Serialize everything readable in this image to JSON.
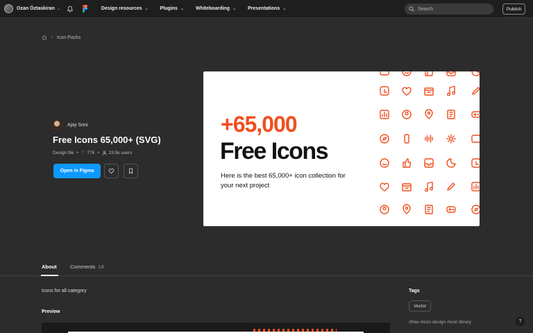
{
  "topbar": {
    "user_name": "Ozan Öztaskiran",
    "nav": [
      {
        "label": "Design resources"
      },
      {
        "label": "Plugins"
      },
      {
        "label": "Whiteboarding"
      },
      {
        "label": "Presentations"
      }
    ],
    "search_placeholder": "Search",
    "publish_label": "Publish"
  },
  "breadcrumb": {
    "items": [
      "Icon Packs"
    ]
  },
  "file": {
    "author": "Ajay Soni",
    "title": "Free Icons 65,000+ (SVG)",
    "type": "Design file",
    "likes": "776",
    "users": "19.5k users",
    "open_label": "Open in Figma"
  },
  "hero": {
    "headline_number": "+65,000",
    "headline_text": "Free Icons",
    "subtext": "Here is the best 65,000+ icon collection for your next project",
    "accent_color": "#f24e1e"
  },
  "tabs": [
    {
      "label": "About",
      "count": ""
    },
    {
      "label": "Comments",
      "count": "14"
    }
  ],
  "about": {
    "description": "Icons for all category",
    "preview_heading": "Preview"
  },
  "tags": {
    "heading": "Tags",
    "chip": "Vector",
    "links": "#free  #icon design  #icon library"
  },
  "help_label": "?",
  "colors": {
    "primary_button": "#0d99ff",
    "background": "#2c2c2c",
    "topbar": "#1e1e1e"
  }
}
